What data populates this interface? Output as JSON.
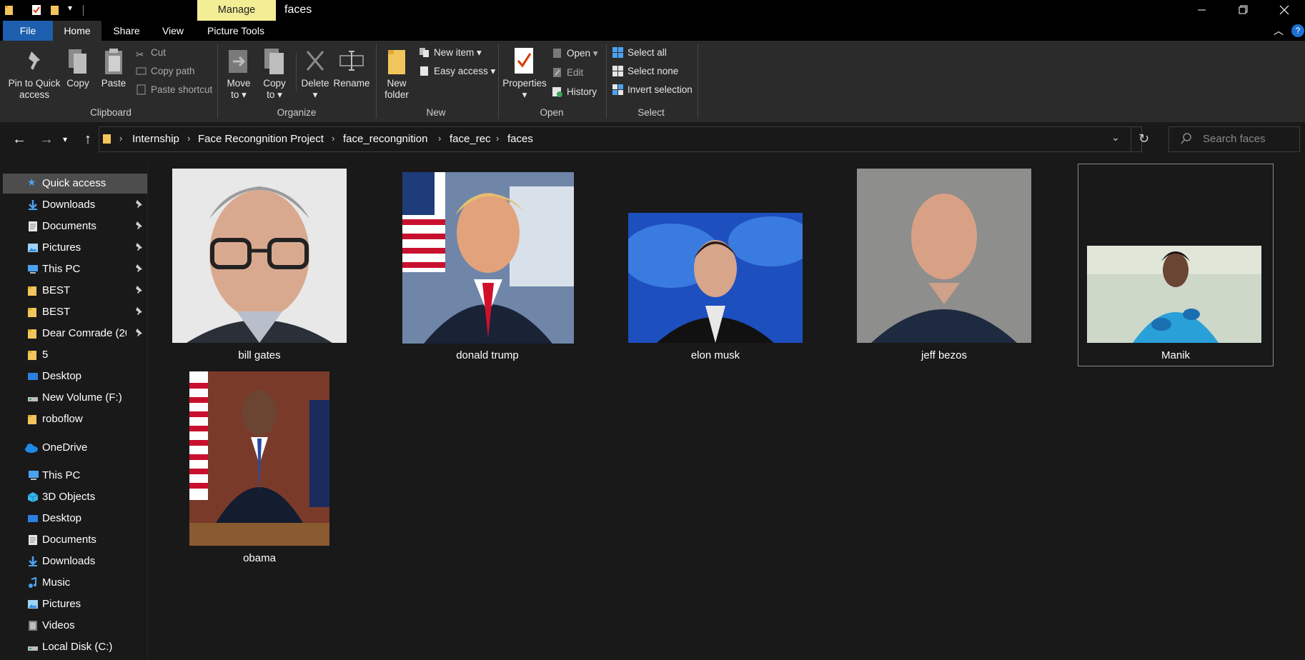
{
  "window": {
    "title": "faces",
    "context_tab": "Manage",
    "buttons": [
      "minimize",
      "restore",
      "close"
    ]
  },
  "ribbon_tabs": [
    "File",
    "Home",
    "Share",
    "View",
    "Picture Tools"
  ],
  "ribbon": {
    "clipboard": {
      "pin_line1": "Pin to Quick",
      "pin_line2": "access",
      "copy": "Copy",
      "paste": "Paste",
      "cut": "Cut",
      "copy_path": "Copy path",
      "paste_shortcut": "Paste shortcut",
      "group": "Clipboard"
    },
    "organize": {
      "move_to_1": "Move",
      "move_to_2": "to",
      "copy_to_1": "Copy",
      "copy_to_2": "to",
      "delete": "Delete",
      "rename": "Rename",
      "group": "Organize"
    },
    "new": {
      "new_folder_1": "New",
      "new_folder_2": "folder",
      "new_item": "New item",
      "easy_access": "Easy access",
      "group": "New"
    },
    "open": {
      "properties": "Properties",
      "open": "Open",
      "edit": "Edit",
      "history": "History",
      "group": "Open"
    },
    "select": {
      "select_all": "Select all",
      "select_none": "Select none",
      "invert_selection": "Invert selection",
      "group": "Select"
    }
  },
  "breadcrumb": [
    "Internship",
    "Face Recongnition Project",
    "face_recongnition",
    "face_rec",
    "faces"
  ],
  "search": {
    "placeholder": "Search faces"
  },
  "sidebar": {
    "quick_access": "Quick access",
    "items": [
      {
        "label": "Downloads",
        "icon": "download-arrow-icon",
        "pinned": true
      },
      {
        "label": "Documents",
        "icon": "document-icon",
        "pinned": true
      },
      {
        "label": "Pictures",
        "icon": "pictures-icon",
        "pinned": true
      },
      {
        "label": "This PC",
        "icon": "computer-icon",
        "pinned": true
      },
      {
        "label": "BEST",
        "icon": "folder-icon",
        "pinned": true
      },
      {
        "label": "BEST",
        "icon": "folder-icon",
        "pinned": true
      },
      {
        "label": "Dear Comrade (20",
        "icon": "folder-icon",
        "pinned": true
      },
      {
        "label": "5",
        "icon": "folder-icon",
        "pinned": false
      },
      {
        "label": "Desktop",
        "icon": "desktop-icon",
        "pinned": false
      },
      {
        "label": "New Volume (F:)",
        "icon": "drive-icon",
        "pinned": false
      },
      {
        "label": "roboflow",
        "icon": "folder-icon",
        "pinned": false
      }
    ],
    "onedrive": "OneDrive",
    "this_pc": "This PC",
    "pc_items": [
      {
        "label": "3D Objects",
        "icon": "cube-icon"
      },
      {
        "label": "Desktop",
        "icon": "desktop-icon"
      },
      {
        "label": "Documents",
        "icon": "document-icon"
      },
      {
        "label": "Downloads",
        "icon": "download-arrow-icon"
      },
      {
        "label": "Music",
        "icon": "music-note-icon"
      },
      {
        "label": "Pictures",
        "icon": "pictures-icon"
      },
      {
        "label": "Videos",
        "icon": "video-icon"
      },
      {
        "label": "Local Disk (C:)",
        "icon": "drive-icon"
      }
    ]
  },
  "files": [
    {
      "name": "bill gates",
      "selected": false
    },
    {
      "name": "donald trump",
      "selected": false
    },
    {
      "name": "elon musk",
      "selected": false
    },
    {
      "name": "jeff bezos",
      "selected": false
    },
    {
      "name": "Manik",
      "selected": true
    },
    {
      "name": "obama",
      "selected": false
    }
  ],
  "colors": {
    "accent_file_tab": "#1d5fae",
    "manage_tab": "#f3ee95",
    "selection": "#4d4d4d",
    "folder": "#f2c55c"
  }
}
